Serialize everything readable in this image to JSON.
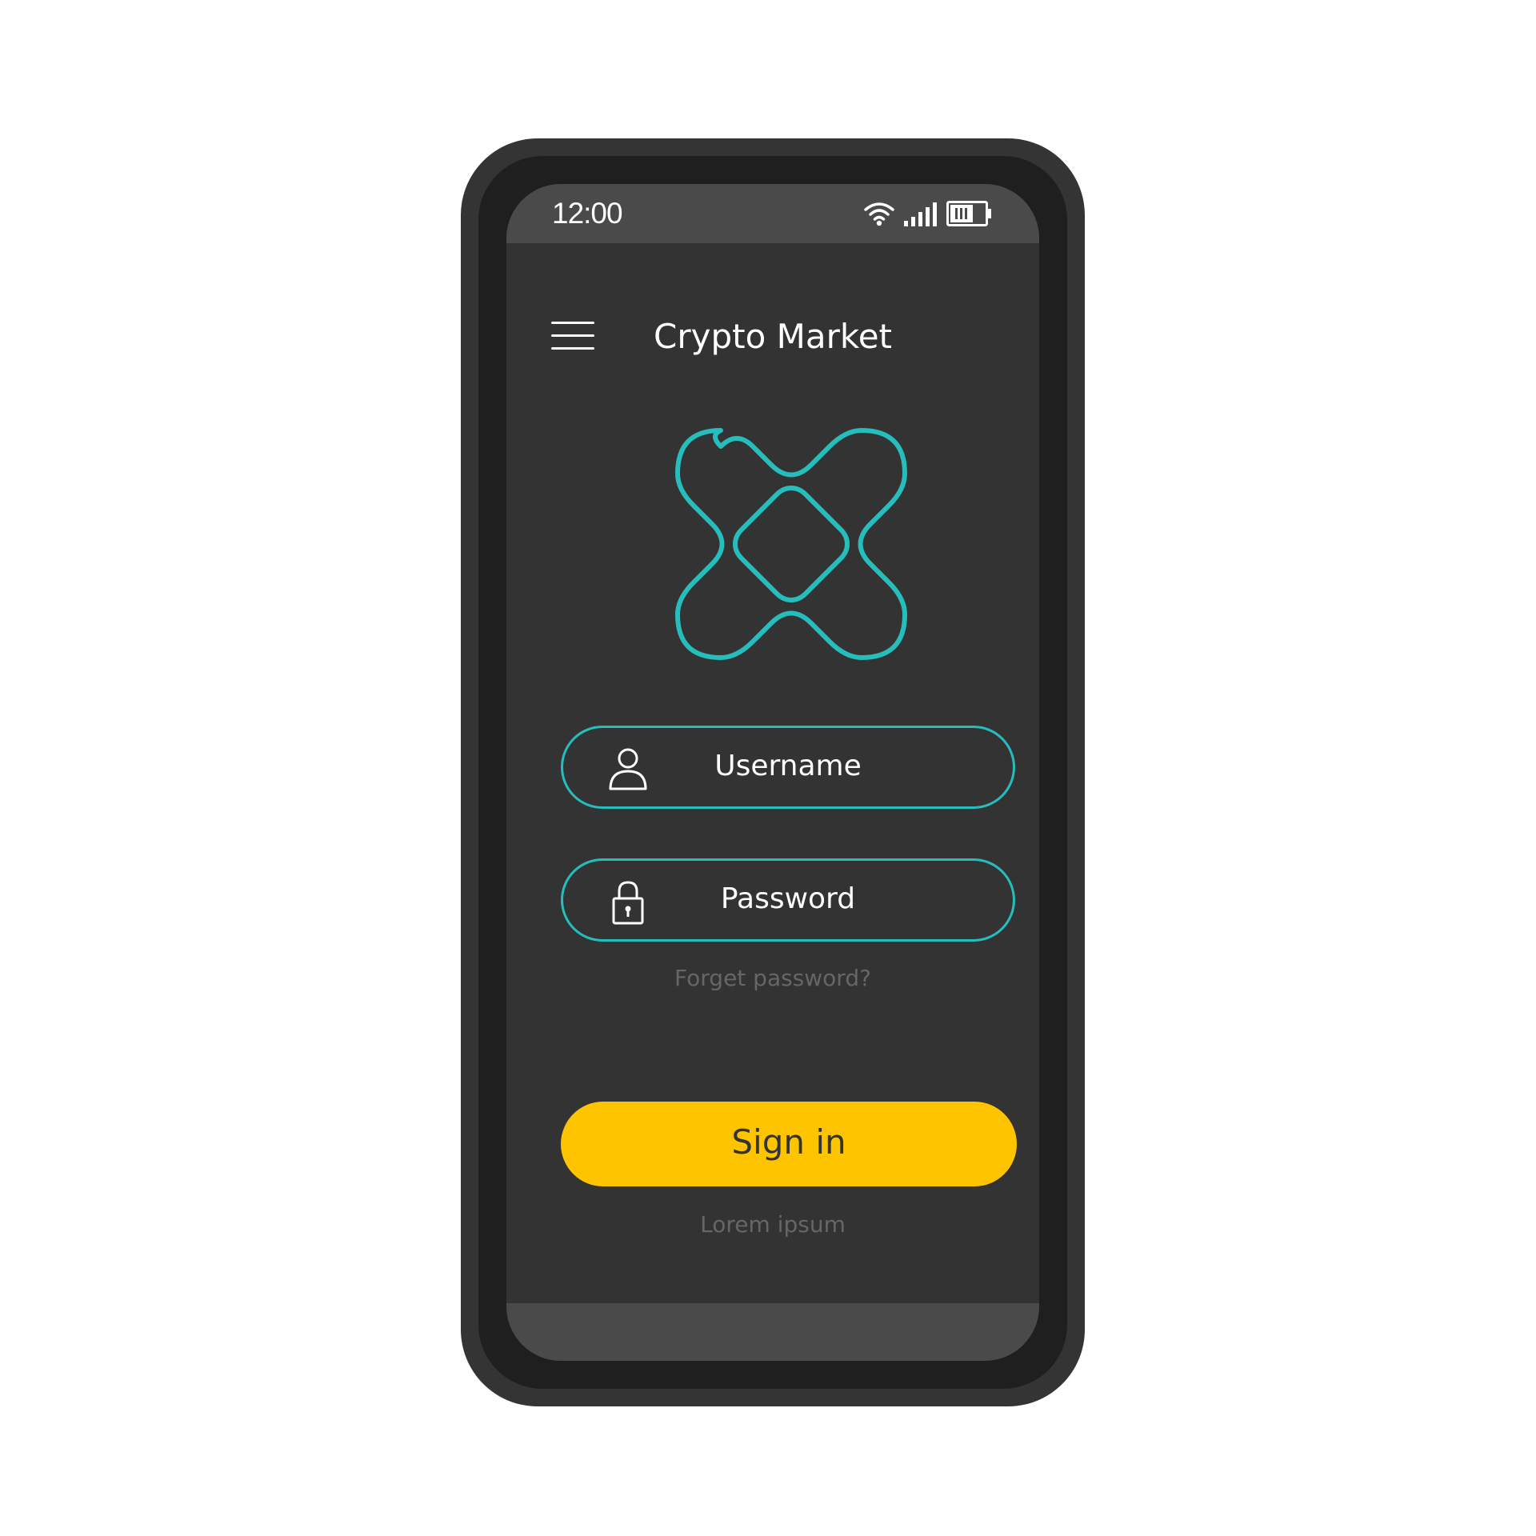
{
  "status_bar": {
    "time": "12:00",
    "icons": [
      "wifi-icon",
      "signal-icon",
      "battery-icon"
    ]
  },
  "header": {
    "menu_icon": "hamburger-menu-icon",
    "title": "Crypto Market"
  },
  "logo": {
    "icon": "crypto-logo-icon"
  },
  "login_form": {
    "username_placeholder": "Username",
    "username_icon": "user-icon",
    "password_placeholder": "Password",
    "password_icon": "lock-icon",
    "forgot_password": "Forget password?",
    "sign_in_label": "Sign in",
    "footer_text": "Lorem ipsum"
  },
  "colors": {
    "screen_background": "#333333",
    "phone_frame": "#343434",
    "bar_background": "#4a4a4a",
    "accent_teal": "#26bdbd",
    "button_yellow": "#fec400",
    "muted_text": "#666666",
    "text_white": "#ffffff"
  }
}
